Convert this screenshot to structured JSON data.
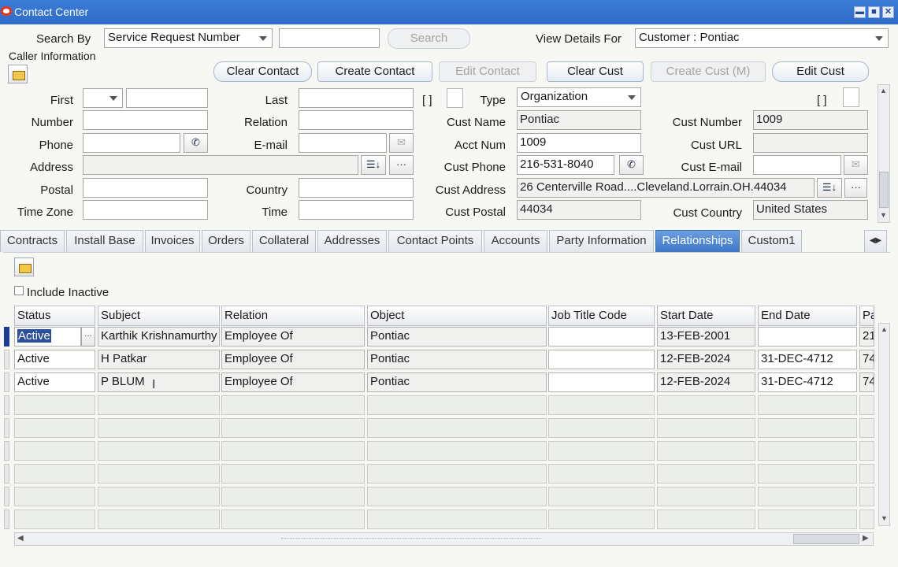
{
  "window": {
    "title": "Contact Center",
    "min": "▬",
    "max": "■",
    "close": "✕"
  },
  "search": {
    "by_label": "Search By",
    "by_value": "Service Request Number",
    "input_value": "",
    "button": "Search",
    "view_label": "View Details For",
    "view_value": "Customer : Pontiac"
  },
  "caller_info_label": "Caller Information",
  "buttons": {
    "clear_contact": "Clear Contact",
    "create_contact": "Create Contact",
    "edit_contact": "Edit Contact",
    "clear_cust": "Clear Cust",
    "create_cust": "Create Cust (M)",
    "edit_cust": "Edit Cust"
  },
  "contact": {
    "first_label": "First",
    "first_value": "",
    "last_label": "Last",
    "last_value": "",
    "number_label": "Number",
    "number_value": "",
    "relation_label": "Relation",
    "relation_value": "",
    "phone_label": "Phone",
    "phone_value": "",
    "email_label": "E-mail",
    "email_value": "",
    "address_label": "Address",
    "address_value": "",
    "postal_label": "Postal",
    "postal_value": "",
    "country_label": "Country",
    "country_value": "",
    "timezone_label": "Time Zone",
    "timezone_value": "",
    "time_label": "Time",
    "time_value": "",
    "bracket": "[ ]"
  },
  "customer": {
    "type_label": "Type",
    "type_value": "Organization",
    "name_label": "Cust Name",
    "name_value": "Pontiac",
    "acct_label": "Acct Num",
    "acct_value": "1009",
    "phone_label": "Cust Phone",
    "phone_value": "216-531-8040",
    "address_label": "Cust Address",
    "address_value": "26 Centerville Road....Cleveland.Lorrain.OH.44034",
    "postal_label": "Cust Postal",
    "postal_value": "44034",
    "number_label": "Cust Number",
    "number_value": "1009",
    "url_label": "Cust URL",
    "url_value": "",
    "email_label": "Cust E-mail",
    "email_value": "",
    "country_label": "Cust Country",
    "country_value": "United States",
    "bracket": "[ ]"
  },
  "tabs": [
    "Contracts",
    "Install Base",
    "Invoices",
    "Orders",
    "Collateral",
    "Addresses",
    "Contact Points",
    "Accounts",
    "Party Information",
    "Relationships",
    "Custom1"
  ],
  "active_tab": "Relationships",
  "relationships": {
    "include_inactive_label": "Include Inactive",
    "columns": [
      "Status",
      "Subject",
      "Relation",
      "Object",
      "Job Title Code",
      "Start Date",
      "End Date",
      "Pa"
    ],
    "rows": [
      {
        "status": "Active",
        "subject": "Karthik Krishnamurthy",
        "relation": "Employee Of",
        "object": "Pontiac",
        "job": "",
        "start": "13-FEB-2001",
        "end": "",
        "pa": "21"
      },
      {
        "status": "Active",
        "subject": "H Patkar",
        "relation": "Employee Of",
        "object": "Pontiac",
        "job": "",
        "start": "12-FEB-2024",
        "end": "31-DEC-4712",
        "pa": "74"
      },
      {
        "status": "Active",
        "subject": "P BLUM",
        "relation": "Employee Of",
        "object": "Pontiac",
        "job": "",
        "start": "12-FEB-2024",
        "end": "31-DEC-4712",
        "pa": "74"
      }
    ]
  }
}
